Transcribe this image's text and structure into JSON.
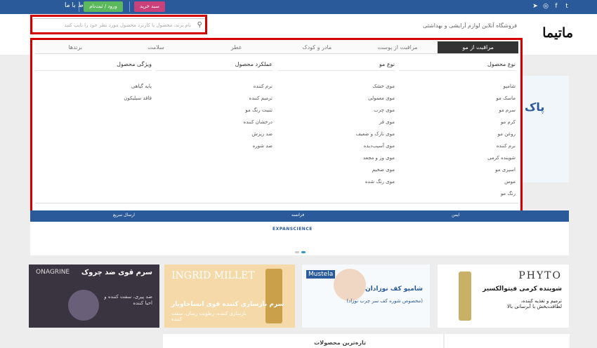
{
  "topbar": {
    "social_icons": [
      "twitter-icon",
      "facebook-icon",
      "instagram-icon",
      "telegram-icon"
    ],
    "contact_label": "ارتباط با ما",
    "login_label": "ورود / ثبت‌نام",
    "cart_label": "سبد خرید"
  },
  "header": {
    "logo_text": "ماتیما",
    "tagline": "فروشگاه آنلاین لوازم آرایشی و بهداشتی",
    "search_placeholder": "نام برند، محصول یا کاربرد محصول مورد نظر خود را تایپ کنید"
  },
  "mega": {
    "tabs": [
      "مراقبت از مو",
      "مراقبت از پوست",
      "مادر و کودک",
      "عطر",
      "سلامت",
      "برندها"
    ],
    "active_tab": 0,
    "columns": [
      {
        "title": "نوع محصول",
        "items": [
          "شامپو",
          "ماسک مو",
          "سرم مو",
          "کرم مو",
          "روغن مو",
          "نرم کننده",
          "شوینده کرمی",
          "اسپری مو",
          "موس",
          "رنگ مو"
        ]
      },
      {
        "title": "نوع مو",
        "items": [
          "موی خشک",
          "موی معمولی",
          "موی چرب",
          "موی فر",
          "موی نازک و ضعیف",
          "موی آسیب‌دیده",
          "موی وز و مجعد",
          "موی ضخیم",
          "موی رنگ شده"
        ]
      },
      {
        "title": "عملکرد محصول",
        "items": [
          "نرم کننده",
          "ترمیم کننده",
          "تثبیت رنگ مو",
          "درخشان کننده",
          "ضد ریزش",
          "ضد شوره"
        ]
      },
      {
        "title": "ویژگی محصول",
        "items": [
          "پایه گیاهی",
          "فاقد سیلیکون"
        ]
      }
    ]
  },
  "blue_bar": {
    "left": "ارسال سریع",
    "mid": "فرانسه",
    "right": "ایمن"
  },
  "expanscience": "EXPANSCIENCE",
  "right_peek": "پاک",
  "ads": {
    "phyto": {
      "brand": "PHYTO",
      "title": "شوینده کرمی فیتوالکسیر",
      "desc": "ترمیم و تغذیه کننده، لطافت‌بخش با آبرسانی بالا"
    },
    "mustela": {
      "brand": "Mustela",
      "title": "شامپو کف نوزادان",
      "desc": "(مخصوص شوره کف سر چرب نوزاد)"
    },
    "ingrid": {
      "brand": "INGRID MILLET",
      "title": "سرم بازسازی کننده قوی انساخاویار",
      "desc": "بازسازی کننده، رطوبت رسان، سفت کننده"
    },
    "onagrine": {
      "brand": "ONAGRINE",
      "title": "سرم قوی ضد چروک",
      "desc": "ضد پیری، سفت کننده و احیا کننده"
    }
  },
  "bottom": {
    "latest_title": "تازه‌ترین محصولات",
    "side_title": ""
  }
}
